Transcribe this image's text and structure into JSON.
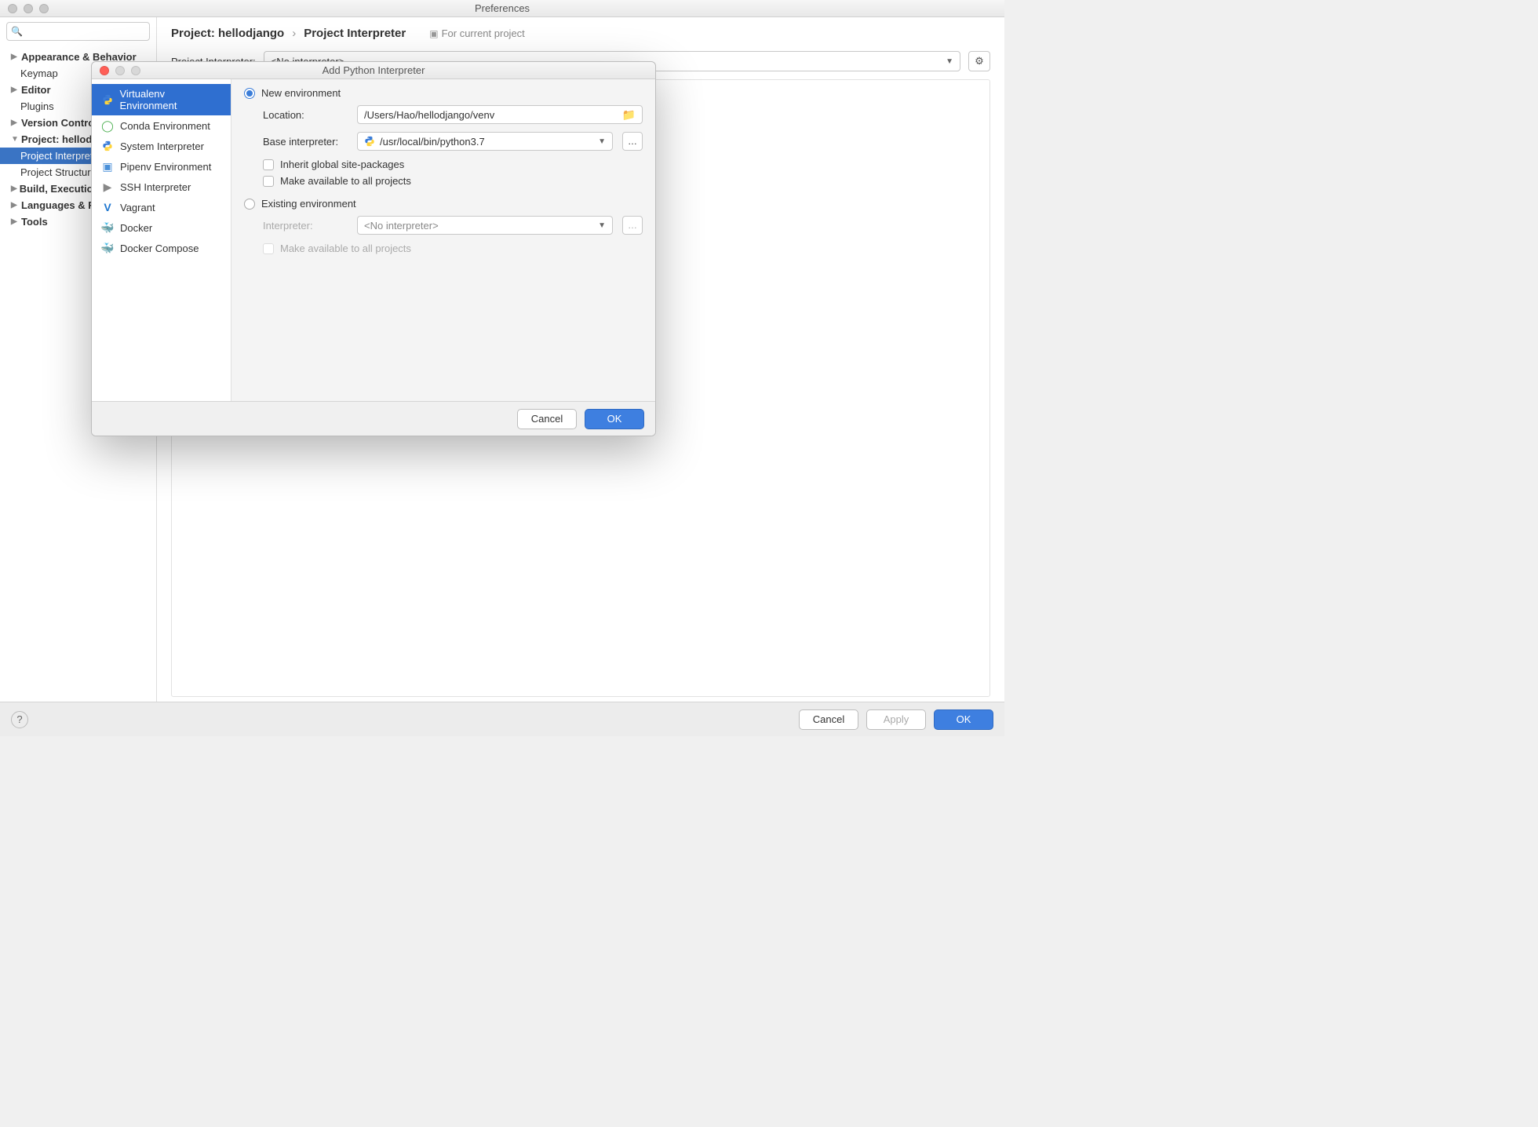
{
  "prefs": {
    "title": "Preferences",
    "search_placeholder": "",
    "tree": {
      "appearance": "Appearance & Behavior",
      "keymap": "Keymap",
      "editor": "Editor",
      "plugins": "Plugins",
      "version_control": "Version Control",
      "project_label": "Project: hellodjango",
      "project_interpreter": "Project Interpreter",
      "project_structure": "Project Structure",
      "build": "Build, Execution, Deployment",
      "languages": "Languages & Frameworks",
      "tools": "Tools"
    },
    "breadcrumb": {
      "project": "Project: hellodjango",
      "section": "Project Interpreter",
      "hint": "For current project"
    },
    "interp_label": "Project Interpreter:",
    "interp_value": "<No interpreter>",
    "buttons": {
      "cancel": "Cancel",
      "apply": "Apply",
      "ok": "OK"
    }
  },
  "modal": {
    "title": "Add Python Interpreter",
    "left": [
      "Virtualenv Environment",
      "Conda Environment",
      "System Interpreter",
      "Pipenv Environment",
      "SSH Interpreter",
      "Vagrant",
      "Docker",
      "Docker Compose"
    ],
    "radio_new": "New environment",
    "radio_existing": "Existing environment",
    "location_label": "Location:",
    "location_value": "/Users/Hao/hellodjango/venv",
    "base_label": "Base interpreter:",
    "base_value": "/usr/local/bin/python3.7",
    "inherit": "Inherit global site-packages",
    "make_all": "Make available to all projects",
    "existing_interp_label": "Interpreter:",
    "existing_interp_value": "<No interpreter>",
    "existing_make_all": "Make available to all projects",
    "buttons": {
      "cancel": "Cancel",
      "ok": "OK"
    }
  },
  "icons": {
    "python": "🐍",
    "conda": "◯",
    "pipenv": "📦",
    "ssh": "▶",
    "vagrant": "V",
    "docker": "🐳",
    "compose": "🐳"
  }
}
